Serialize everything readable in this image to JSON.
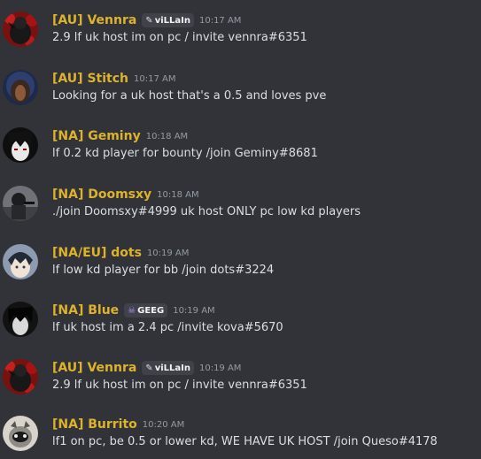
{
  "messages": [
    {
      "name": "[AU] Vennra",
      "tag": "viLLaIn",
      "tag_icon": "✎",
      "time": "10:17 AM",
      "text": "2.9 lf uk host im on pc / invite vennra#6351",
      "avatar": "vennra"
    },
    {
      "name": "[AU] Stitch",
      "tag": null,
      "time": "10:17 AM",
      "text": "Looking for a uk host that's a 0.5 and loves pve",
      "avatar": "stitch"
    },
    {
      "name": "[NA] Geminy",
      "tag": null,
      "time": "10:18 AM",
      "text": "lf 0.2 kd player for bounty /join Geminy#8681",
      "avatar": "geminy"
    },
    {
      "name": "[NA] Doomsxy",
      "tag": null,
      "time": "10:18 AM",
      "text": "./join Doomsxy#4999 uk host ONLY pc low kd players",
      "avatar": "doomsxy"
    },
    {
      "name": "[NA/EU] dots",
      "tag": null,
      "time": "10:19 AM",
      "text": "lf low kd player for bb /join dots#3224",
      "avatar": "dots"
    },
    {
      "name": "[NA] Blue",
      "tag": "GEEG",
      "tag_icon": "☠",
      "time": "10:19 AM",
      "text": "lf uk host im a 2.4 pc /invite kova#5670",
      "avatar": "blue"
    },
    {
      "name": "[AU] Vennra",
      "tag": "viLLaIn",
      "tag_icon": "✎",
      "time": "10:19 AM",
      "text": "2.9 lf uk host im on pc / invite vennra#6351",
      "avatar": "vennra"
    },
    {
      "name": "[NA] Burrito",
      "tag": null,
      "time": "10:20 AM",
      "text": "lf1 on pc, be 0.5 or lower kd, WE HAVE UK HOST /join Queso#4178",
      "avatar": "burrito"
    }
  ],
  "colors": {
    "background": "#313338",
    "username": "#ddb32b",
    "text": "#dbdee1",
    "time": "#949ba4"
  }
}
